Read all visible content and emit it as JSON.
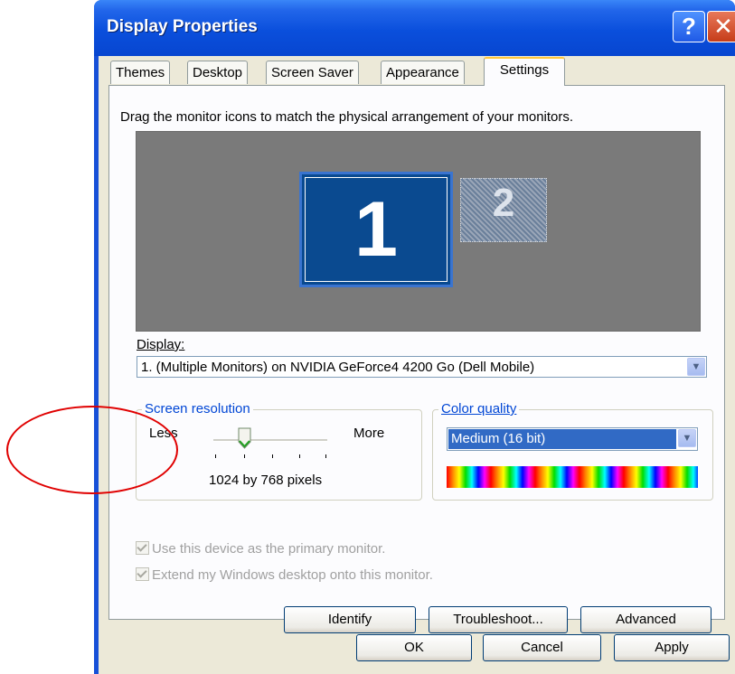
{
  "window": {
    "title": "Display Properties"
  },
  "titlebar": {
    "help_glyph": "?",
    "close_glyph": "✕"
  },
  "tabs": [
    {
      "label": "Themes"
    },
    {
      "label": "Desktop"
    },
    {
      "label": "Screen Saver"
    },
    {
      "label": "Appearance"
    },
    {
      "label": "Settings",
      "selected": true
    }
  ],
  "settings": {
    "instruction": "Drag the monitor icons to match the physical arrangement of your monitors.",
    "monitors": [
      {
        "number": "1",
        "selected": true
      },
      {
        "number": "2",
        "selected": false
      }
    ],
    "display_label": "Display:",
    "display_value": "1. (Multiple Monitors) on NVIDIA GeForce4 4200 Go (Dell Mobile)",
    "resolution": {
      "legend": "Screen resolution",
      "less": "Less",
      "more": "More",
      "value": "1024 by 768 pixels",
      "slider_fraction": 0.27
    },
    "color_quality": {
      "legend": "Color quality",
      "value": "Medium (16 bit)"
    },
    "checkboxes": [
      {
        "label": "Use this device as the primary monitor.",
        "checked": true,
        "enabled": false
      },
      {
        "label": "Extend my Windows desktop onto this monitor.",
        "checked": true,
        "enabled": false
      }
    ],
    "buttons": {
      "identify": "Identify",
      "troubleshoot": "Troubleshoot...",
      "advanced": "Advanced"
    }
  },
  "dialog_buttons": {
    "ok": "OK",
    "cancel": "Cancel",
    "apply": "Apply"
  },
  "colors": {
    "titlebar": "#0a4fdc",
    "dialog_bg": "#ece9d8",
    "accent_tab": "#ffc73c",
    "annotation": "#e00000",
    "selection": "#316ac5"
  }
}
